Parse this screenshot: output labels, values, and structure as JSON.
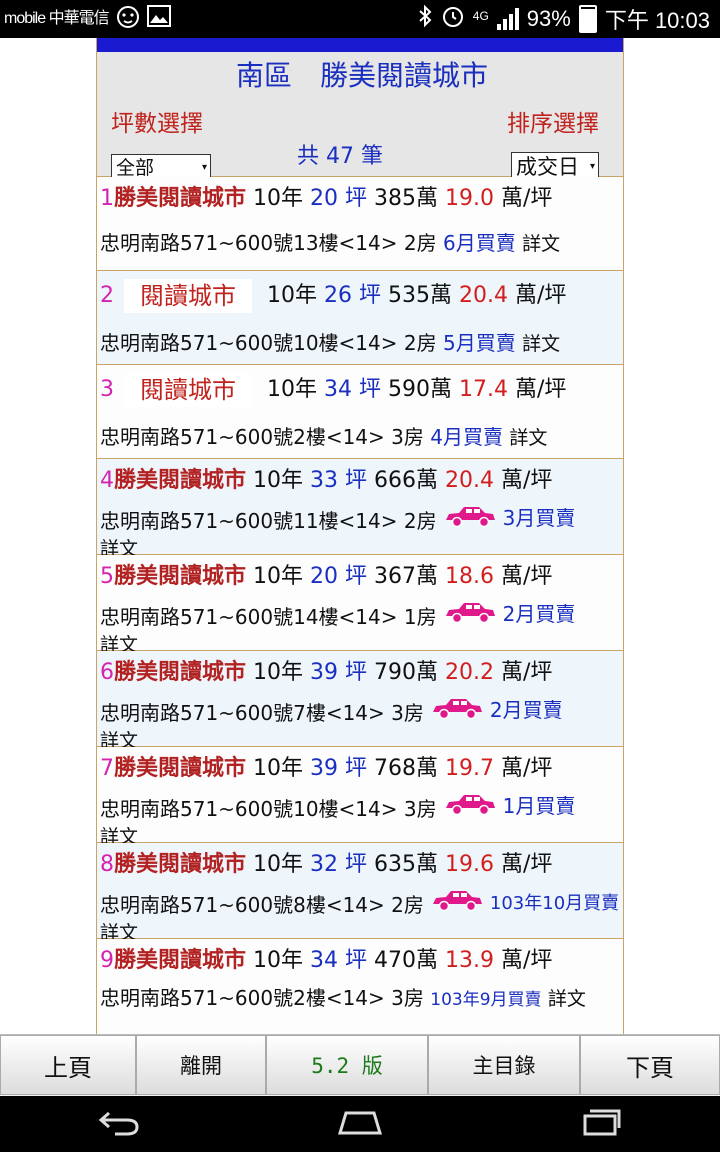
{
  "status_bar": {
    "carrier": "mobile 中華電信",
    "network": "4G",
    "battery": "93%",
    "battery_level": 0.93,
    "time": "下午 10:03"
  },
  "header": {
    "title": "南區　勝美閱讀城市",
    "count": "共 47 筆",
    "size_label": "坪數選擇",
    "size_value": "全部",
    "sort_label": "排序選擇",
    "sort_value": "成交日"
  },
  "listings": [
    {
      "no": "1",
      "name": "勝美閱讀城市",
      "age": "10年",
      "ping": "20",
      "ping_unit": "坪",
      "price": "385萬",
      "unit_price": "19.0",
      "unit_label": "萬/坪",
      "address": "忠明南路571~600號13樓<14> 2房",
      "car": false,
      "date": "6月買賣",
      "detail": "詳文",
      "name_as_image": false
    },
    {
      "no": "2",
      "name": "閱讀城市",
      "age": "10年",
      "ping": "26",
      "ping_unit": "坪",
      "price": "535萬",
      "unit_price": "20.4",
      "unit_label": "萬/坪",
      "address": "忠明南路571~600號10樓<14> 2房",
      "car": false,
      "date": "5月買賣",
      "detail": "詳文",
      "name_as_image": true
    },
    {
      "no": "3",
      "name": "閱讀城市",
      "age": "10年",
      "ping": "34",
      "ping_unit": "坪",
      "price": "590萬",
      "unit_price": "17.4",
      "unit_label": "萬/坪",
      "address": "忠明南路571~600號2樓<14> 3房",
      "car": false,
      "date": "4月買賣",
      "detail": "詳文",
      "name_as_image": true
    },
    {
      "no": "4",
      "name": "勝美閱讀城市",
      "age": "10年",
      "ping": "33",
      "ping_unit": "坪",
      "price": "666萬",
      "unit_price": "20.4",
      "unit_label": "萬/坪",
      "address": "忠明南路571~600號11樓<14> 2房",
      "car": true,
      "date": "3月買賣",
      "detail": "詳文",
      "name_as_image": false
    },
    {
      "no": "5",
      "name": "勝美閱讀城市",
      "age": "10年",
      "ping": "20",
      "ping_unit": "坪",
      "price": "367萬",
      "unit_price": "18.6",
      "unit_label": "萬/坪",
      "address": "忠明南路571~600號14樓<14> 1房",
      "car": true,
      "date": "2月買賣",
      "detail": "詳文",
      "name_as_image": false
    },
    {
      "no": "6",
      "name": "勝美閱讀城市",
      "age": "10年",
      "ping": "39",
      "ping_unit": "坪",
      "price": "790萬",
      "unit_price": "20.2",
      "unit_label": "萬/坪",
      "address": "忠明南路571~600號7樓<14> 3房",
      "car": true,
      "date": "2月買賣",
      "detail": "詳文",
      "name_as_image": false
    },
    {
      "no": "7",
      "name": "勝美閱讀城市",
      "age": "10年",
      "ping": "39",
      "ping_unit": "坪",
      "price": "768萬",
      "unit_price": "19.7",
      "unit_label": "萬/坪",
      "address": "忠明南路571~600號10樓<14> 3房",
      "car": true,
      "date": "1月買賣",
      "detail": "詳文",
      "name_as_image": false
    },
    {
      "no": "8",
      "name": "勝美閱讀城市",
      "age": "10年",
      "ping": "32",
      "ping_unit": "坪",
      "price": "635萬",
      "unit_price": "19.6",
      "unit_label": "萬/坪",
      "address": "忠明南路571~600號8樓<14> 2房",
      "car": true,
      "date": "103年10月買賣",
      "detail": "詳文",
      "name_as_image": false
    },
    {
      "no": "9",
      "name": "勝美閱讀城市",
      "age": "10年",
      "ping": "34",
      "ping_unit": "坪",
      "price": "470萬",
      "unit_price": "13.9",
      "unit_label": "萬/坪",
      "address": "忠明南路571~600號2樓<14> 3房",
      "car": false,
      "date": "103年9月買賣",
      "detail": "詳文",
      "name_as_image": false
    }
  ],
  "buttons": {
    "prev": "上頁",
    "leave": "離開",
    "version": "5.2 版",
    "menu": "主目錄",
    "next": "下頁"
  },
  "colors": {
    "title_blue": "#1a2fbf",
    "label_red": "#c0231e",
    "number_magenta": "#d323b0",
    "car_pink": "#e0198a",
    "version_green": "#1c7a1c"
  },
  "icons": {
    "car": "car-icon",
    "back": "back-icon",
    "home": "home-icon",
    "recents": "recents-icon"
  }
}
